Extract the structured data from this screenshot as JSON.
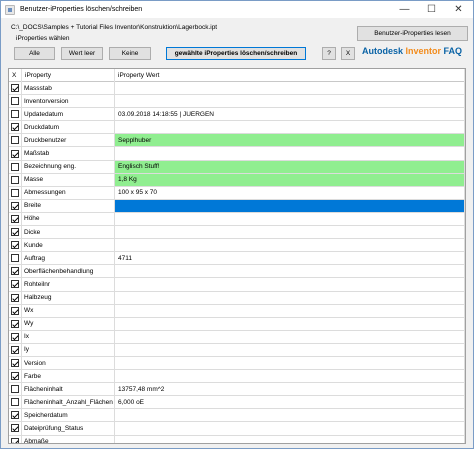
{
  "window": {
    "title": "Benutzer-iProperties löschen/schreiben",
    "controls": [
      "—",
      "☐",
      "✕"
    ]
  },
  "path": "C:\\_DOCS\\Samples + Tutorial Files Inventor\\Konstruktion\\Lagerbock.ipt",
  "sublabel": "iProperties wählen",
  "buttons": {
    "lesen": "Benutzer-iProperties lesen",
    "alle": "Alle",
    "wert_leer": "Wert leer",
    "keine": "Keine",
    "delete_write": "gewählte iProperties löschen/schreiben",
    "help": "?",
    "close_x": "X"
  },
  "brand": {
    "part1": "Autodesk ",
    "part2": "Inventor",
    "part3": " FAQ"
  },
  "grid": {
    "headers": [
      "X",
      "iProperty",
      "iProperty Wert"
    ],
    "rows": [
      {
        "checked": true,
        "name": "Massstab",
        "value": "",
        "highlight": "none"
      },
      {
        "checked": false,
        "name": "Inventorversion",
        "value": "",
        "highlight": "none"
      },
      {
        "checked": false,
        "name": "Updatedatum",
        "value": "03.09.2018 14:18:55 | JUERGEN",
        "highlight": "none"
      },
      {
        "checked": true,
        "name": "Druckdatum",
        "value": "",
        "highlight": "none"
      },
      {
        "checked": false,
        "name": "Druckbenutzer",
        "value": "Sepplhuber",
        "highlight": "green"
      },
      {
        "checked": true,
        "name": "Maßstab",
        "value": "",
        "highlight": "none"
      },
      {
        "checked": false,
        "name": "Bezeichnung eng.",
        "value": "Englisch Stuff!",
        "highlight": "green"
      },
      {
        "checked": false,
        "name": "Masse",
        "value": "1,8 Kg",
        "highlight": "green"
      },
      {
        "checked": false,
        "name": "Abmessungen",
        "value": "100 x 95 x 70",
        "highlight": "none"
      },
      {
        "checked": true,
        "name": "Breite",
        "value": "",
        "highlight": "blue"
      },
      {
        "checked": true,
        "name": "Höhe",
        "value": "",
        "highlight": "none"
      },
      {
        "checked": true,
        "name": "Dicke",
        "value": "",
        "highlight": "none"
      },
      {
        "checked": true,
        "name": "Kunde",
        "value": "",
        "highlight": "none"
      },
      {
        "checked": false,
        "name": "Auftrag",
        "value": "4711",
        "highlight": "none"
      },
      {
        "checked": true,
        "name": "Oberflächenbehandlung",
        "value": "",
        "highlight": "none"
      },
      {
        "checked": true,
        "name": "Rohteilnr",
        "value": "",
        "highlight": "none"
      },
      {
        "checked": true,
        "name": "Halbzeug",
        "value": "",
        "highlight": "none"
      },
      {
        "checked": true,
        "name": "Wx",
        "value": "",
        "highlight": "none"
      },
      {
        "checked": true,
        "name": "Wy",
        "value": "",
        "highlight": "none"
      },
      {
        "checked": true,
        "name": "Ix",
        "value": "",
        "highlight": "none"
      },
      {
        "checked": true,
        "name": "Iy",
        "value": "",
        "highlight": "none"
      },
      {
        "checked": true,
        "name": "Version",
        "value": "",
        "highlight": "none"
      },
      {
        "checked": true,
        "name": "Farbe",
        "value": "",
        "highlight": "none"
      },
      {
        "checked": false,
        "name": "Flächeninhalt",
        "value": "13757,48 mm^2",
        "highlight": "none"
      },
      {
        "checked": false,
        "name": "Flächeninhalt_Anzahl_Flächen",
        "value": "6,000 oE",
        "highlight": "none"
      },
      {
        "checked": true,
        "name": "Speicherdatum",
        "value": "",
        "highlight": "none"
      },
      {
        "checked": true,
        "name": "Dateiprüfung_Status",
        "value": "",
        "highlight": "none"
      },
      {
        "checked": true,
        "name": "Abmaße",
        "value": "",
        "highlight": "none"
      }
    ]
  },
  "colors": {
    "green": "#90ee90",
    "selected": "#0078d7",
    "brand_blue": "#0a63a6",
    "brand_orange": "#f28c1e"
  }
}
